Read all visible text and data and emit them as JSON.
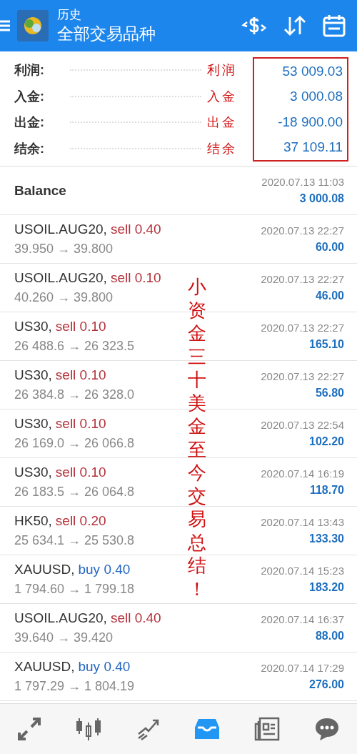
{
  "header": {
    "title": "历史",
    "subtitle": "全部交易品种"
  },
  "summary": [
    {
      "label": "利润:",
      "note": "利润",
      "value": "53 009.03"
    },
    {
      "label": "入金:",
      "note": "入金",
      "value": "3 000.08"
    },
    {
      "label": "出金:",
      "note": "出金",
      "value": "-18 900.00"
    },
    {
      "label": "结余:",
      "note": "结余",
      "value": "37 109.11"
    }
  ],
  "balance": {
    "label": "Balance",
    "time": "2020.07.13 11:03",
    "amount": "3 000.08"
  },
  "trades": [
    {
      "symbol": "USOIL.AUG20,",
      "kind": "sell",
      "order": "sell 0.40",
      "prices": "39.950 → 39.800",
      "time": "2020.07.13 22:27",
      "profit": "60.00"
    },
    {
      "symbol": "USOIL.AUG20,",
      "kind": "sell",
      "order": "sell 0.10",
      "prices": "40.260 → 39.800",
      "time": "2020.07.13 22:27",
      "profit": "46.00"
    },
    {
      "symbol": "US30,",
      "kind": "sell",
      "order": "sell 0.10",
      "prices": "26 488.6 → 26 323.5",
      "time": "2020.07.13 22:27",
      "profit": "165.10"
    },
    {
      "symbol": "US30,",
      "kind": "sell",
      "order": "sell 0.10",
      "prices": "26 384.8 → 26 328.0",
      "time": "2020.07.13 22:27",
      "profit": "56.80"
    },
    {
      "symbol": "US30,",
      "kind": "sell",
      "order": "sell 0.10",
      "prices": "26 169.0 → 26 066.8",
      "time": "2020.07.13 22:54",
      "profit": "102.20"
    },
    {
      "symbol": "US30,",
      "kind": "sell",
      "order": "sell 0.10",
      "prices": "26 183.5 → 26 064.8",
      "time": "2020.07.14 16:19",
      "profit": "118.70"
    },
    {
      "symbol": "HK50,",
      "kind": "sell",
      "order": "sell 0.20",
      "prices": "25 634.1 → 25 530.8",
      "time": "2020.07.14 13:43",
      "profit": "133.30"
    },
    {
      "symbol": "XAUUSD,",
      "kind": "buy",
      "order": "buy 0.40",
      "prices": "1 794.60 → 1 799.18",
      "time": "2020.07.14 15:23",
      "profit": "183.20"
    },
    {
      "symbol": "USOIL.AUG20,",
      "kind": "sell",
      "order": "sell 0.40",
      "prices": "39.640 → 39.420",
      "time": "2020.07.14 16:37",
      "profit": "88.00"
    },
    {
      "symbol": "XAUUSD,",
      "kind": "buy",
      "order": "buy 0.40",
      "prices": "1 797.29 → 1 804.19",
      "time": "2020.07.14 17:29",
      "profit": "276.00"
    }
  ],
  "annotation": "小资金三十美金至今交易总结！",
  "nav": [
    {
      "kind": "trade",
      "selected": false
    },
    {
      "kind": "chart",
      "selected": false
    },
    {
      "kind": "trend",
      "selected": false
    },
    {
      "kind": "history",
      "selected": true
    },
    {
      "kind": "news",
      "selected": false
    },
    {
      "kind": "chat",
      "selected": false
    }
  ]
}
